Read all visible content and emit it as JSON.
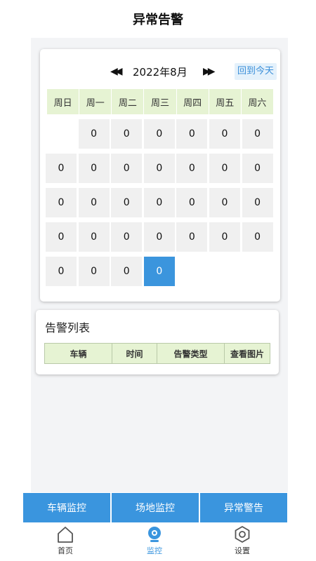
{
  "header": {
    "title": "异常告警"
  },
  "calendar": {
    "prev_symbol": "◀◀",
    "month_label": "2022年8月",
    "next_symbol": "▶▶",
    "today_button": "回到今天",
    "weekdays": [
      "周日",
      "周一",
      "周二",
      "周三",
      "周四",
      "周五",
      "周六"
    ],
    "cells": [
      "",
      "0",
      "0",
      "0",
      "0",
      "0",
      "0",
      "0",
      "0",
      "0",
      "0",
      "0",
      "0",
      "0",
      "0",
      "0",
      "0",
      "0",
      "0",
      "0",
      "0",
      "0",
      "0",
      "0",
      "0",
      "0",
      "0",
      "0",
      "0",
      "0",
      "0",
      "0",
      "",
      "",
      ""
    ],
    "selected_index": 31,
    "selected_color": "#3b95dd"
  },
  "alarm_list": {
    "title": "告警列表",
    "columns": [
      "车辆",
      "时间",
      "告警类型",
      "查看图片"
    ]
  },
  "tabs": [
    {
      "label": "车辆监控"
    },
    {
      "label": "场地监控"
    },
    {
      "label": "异常警告"
    }
  ],
  "bottom_nav": [
    {
      "label": "首页",
      "icon": "home-icon"
    },
    {
      "label": "监控",
      "icon": "camera-icon",
      "active": true
    },
    {
      "label": "设置",
      "icon": "gear-icon"
    }
  ],
  "colors": {
    "accent": "#3a95de",
    "header_green": "#e6f3d3",
    "cell_bg": "#f0f0f0",
    "content_bg": "#f3f4f6"
  }
}
